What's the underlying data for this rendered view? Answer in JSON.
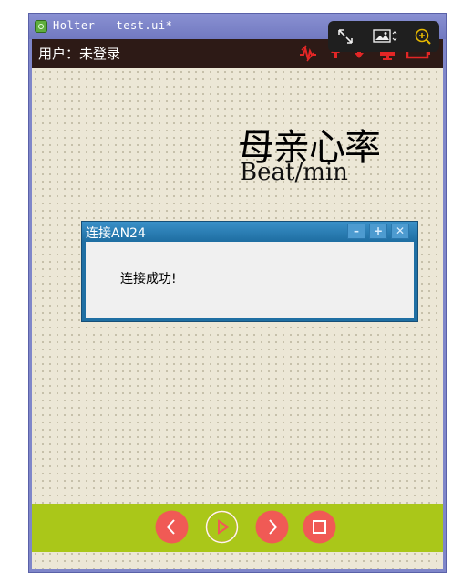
{
  "window": {
    "title": "Holter - test.ui*",
    "icon": "qt-designer-icon"
  },
  "overlay_toolbar": {
    "icons": [
      "fullscreen-icon",
      "image-icon",
      "zoom-in-icon"
    ]
  },
  "header": {
    "user_label": "用户：未登录",
    "icons": [
      "heartbeat-icon",
      "arrow-up-icon",
      "arrow-down-icon",
      "monitor-icon",
      "battery-icon"
    ],
    "icon_color": "#e32626"
  },
  "main": {
    "title": "母亲心率",
    "unit": "Beat/min"
  },
  "dialog": {
    "title": "连接AN24",
    "buttons": [
      "–",
      "+",
      "✕"
    ],
    "message": "连接成功!"
  },
  "controls": {
    "buttons": [
      "prev-icon",
      "play-icon",
      "next-icon",
      "stop-icon"
    ],
    "accent": "#f05a55",
    "bar_color": "#aac719"
  }
}
